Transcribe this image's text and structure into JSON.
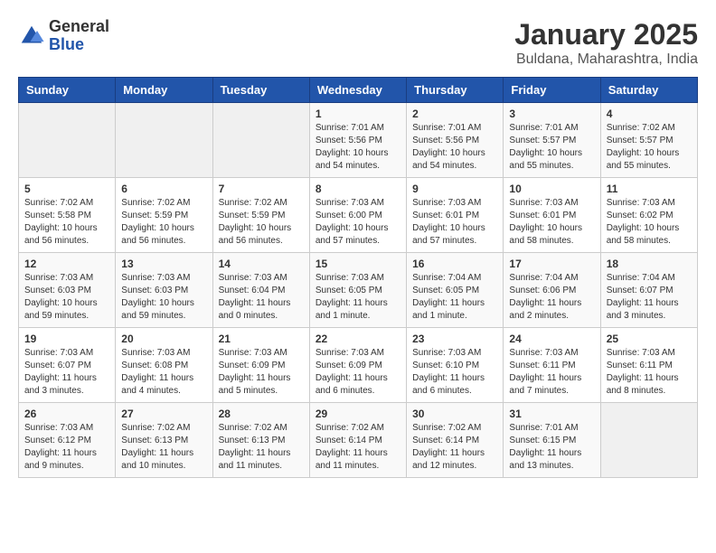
{
  "logo": {
    "general": "General",
    "blue": "Blue"
  },
  "title": "January 2025",
  "subtitle": "Buldana, Maharashtra, India",
  "headers": [
    "Sunday",
    "Monday",
    "Tuesday",
    "Wednesday",
    "Thursday",
    "Friday",
    "Saturday"
  ],
  "weeks": [
    [
      {
        "num": "",
        "info": ""
      },
      {
        "num": "",
        "info": ""
      },
      {
        "num": "",
        "info": ""
      },
      {
        "num": "1",
        "info": "Sunrise: 7:01 AM\nSunset: 5:56 PM\nDaylight: 10 hours\nand 54 minutes."
      },
      {
        "num": "2",
        "info": "Sunrise: 7:01 AM\nSunset: 5:56 PM\nDaylight: 10 hours\nand 54 minutes."
      },
      {
        "num": "3",
        "info": "Sunrise: 7:01 AM\nSunset: 5:57 PM\nDaylight: 10 hours\nand 55 minutes."
      },
      {
        "num": "4",
        "info": "Sunrise: 7:02 AM\nSunset: 5:57 PM\nDaylight: 10 hours\nand 55 minutes."
      }
    ],
    [
      {
        "num": "5",
        "info": "Sunrise: 7:02 AM\nSunset: 5:58 PM\nDaylight: 10 hours\nand 56 minutes."
      },
      {
        "num": "6",
        "info": "Sunrise: 7:02 AM\nSunset: 5:59 PM\nDaylight: 10 hours\nand 56 minutes."
      },
      {
        "num": "7",
        "info": "Sunrise: 7:02 AM\nSunset: 5:59 PM\nDaylight: 10 hours\nand 56 minutes."
      },
      {
        "num": "8",
        "info": "Sunrise: 7:03 AM\nSunset: 6:00 PM\nDaylight: 10 hours\nand 57 minutes."
      },
      {
        "num": "9",
        "info": "Sunrise: 7:03 AM\nSunset: 6:01 PM\nDaylight: 10 hours\nand 57 minutes."
      },
      {
        "num": "10",
        "info": "Sunrise: 7:03 AM\nSunset: 6:01 PM\nDaylight: 10 hours\nand 58 minutes."
      },
      {
        "num": "11",
        "info": "Sunrise: 7:03 AM\nSunset: 6:02 PM\nDaylight: 10 hours\nand 58 minutes."
      }
    ],
    [
      {
        "num": "12",
        "info": "Sunrise: 7:03 AM\nSunset: 6:03 PM\nDaylight: 10 hours\nand 59 minutes."
      },
      {
        "num": "13",
        "info": "Sunrise: 7:03 AM\nSunset: 6:03 PM\nDaylight: 10 hours\nand 59 minutes."
      },
      {
        "num": "14",
        "info": "Sunrise: 7:03 AM\nSunset: 6:04 PM\nDaylight: 11 hours\nand 0 minutes."
      },
      {
        "num": "15",
        "info": "Sunrise: 7:03 AM\nSunset: 6:05 PM\nDaylight: 11 hours\nand 1 minute."
      },
      {
        "num": "16",
        "info": "Sunrise: 7:04 AM\nSunset: 6:05 PM\nDaylight: 11 hours\nand 1 minute."
      },
      {
        "num": "17",
        "info": "Sunrise: 7:04 AM\nSunset: 6:06 PM\nDaylight: 11 hours\nand 2 minutes."
      },
      {
        "num": "18",
        "info": "Sunrise: 7:04 AM\nSunset: 6:07 PM\nDaylight: 11 hours\nand 3 minutes."
      }
    ],
    [
      {
        "num": "19",
        "info": "Sunrise: 7:03 AM\nSunset: 6:07 PM\nDaylight: 11 hours\nand 3 minutes."
      },
      {
        "num": "20",
        "info": "Sunrise: 7:03 AM\nSunset: 6:08 PM\nDaylight: 11 hours\nand 4 minutes."
      },
      {
        "num": "21",
        "info": "Sunrise: 7:03 AM\nSunset: 6:09 PM\nDaylight: 11 hours\nand 5 minutes."
      },
      {
        "num": "22",
        "info": "Sunrise: 7:03 AM\nSunset: 6:09 PM\nDaylight: 11 hours\nand 6 minutes."
      },
      {
        "num": "23",
        "info": "Sunrise: 7:03 AM\nSunset: 6:10 PM\nDaylight: 11 hours\nand 6 minutes."
      },
      {
        "num": "24",
        "info": "Sunrise: 7:03 AM\nSunset: 6:11 PM\nDaylight: 11 hours\nand 7 minutes."
      },
      {
        "num": "25",
        "info": "Sunrise: 7:03 AM\nSunset: 6:11 PM\nDaylight: 11 hours\nand 8 minutes."
      }
    ],
    [
      {
        "num": "26",
        "info": "Sunrise: 7:03 AM\nSunset: 6:12 PM\nDaylight: 11 hours\nand 9 minutes."
      },
      {
        "num": "27",
        "info": "Sunrise: 7:02 AM\nSunset: 6:13 PM\nDaylight: 11 hours\nand 10 minutes."
      },
      {
        "num": "28",
        "info": "Sunrise: 7:02 AM\nSunset: 6:13 PM\nDaylight: 11 hours\nand 11 minutes."
      },
      {
        "num": "29",
        "info": "Sunrise: 7:02 AM\nSunset: 6:14 PM\nDaylight: 11 hours\nand 11 minutes."
      },
      {
        "num": "30",
        "info": "Sunrise: 7:02 AM\nSunset: 6:14 PM\nDaylight: 11 hours\nand 12 minutes."
      },
      {
        "num": "31",
        "info": "Sunrise: 7:01 AM\nSunset: 6:15 PM\nDaylight: 11 hours\nand 13 minutes."
      },
      {
        "num": "",
        "info": ""
      }
    ]
  ]
}
